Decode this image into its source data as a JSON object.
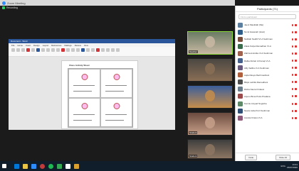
{
  "window": {
    "title": "Zoom Meeting",
    "recording_label": "Recording"
  },
  "shared_doc": {
    "word_title": "Document - Word",
    "tabs": [
      "File",
      "Home",
      "Insert",
      "Design",
      "Layout",
      "References",
      "Mailings",
      "Review",
      "View"
    ],
    "page_heading": "Class Activity Sheet"
  },
  "tiles": [
    {
      "name": "Teacher",
      "colors": [
        "#6a7b64",
        "#c9b9a3"
      ],
      "active": true
    },
    {
      "name": "",
      "colors": [
        "#4a4742",
        "#8a6e55"
      ],
      "active": false
    },
    {
      "name": "",
      "colors": [
        "#3b5e9a",
        "#c68d4a"
      ],
      "active": false
    },
    {
      "name": "Student",
      "colors": [
        "#6b4b3f",
        "#c7a089"
      ],
      "active": false
    },
    {
      "name": "Student",
      "colors": [
        "#3e3e3e",
        "#8d7662"
      ],
      "active": false
    }
  ],
  "participants": {
    "title": "Participants (71)",
    "search_placeholder": "Find a participant",
    "items": [
      {
        "name": "Jaeni Maulidah (Me)",
        "color": "#5c7fa0"
      },
      {
        "name": "Nurul Hasanah (Host)",
        "color": "#2e5d8a"
      },
      {
        "name": "Nabilah Nadhif VI-A Sudirman",
        "color": "#7a4e3c"
      },
      {
        "name": "Zakia Kalya Ramadhan VI-A",
        "color": "#3b6d4d"
      },
      {
        "name": "Zahira Anindita VI-A Sudirman",
        "color": "#a0624f"
      },
      {
        "name": "Rafka Zubair Al Faruqi VI-A",
        "color": "#46618c"
      },
      {
        "name": "Alfiy Saliha VI-A Sudirman",
        "color": "#6a5a7d"
      },
      {
        "name": "Aqila Rasya Rachmadzani",
        "color": "#b05f3c"
      },
      {
        "name": "Bilqis Lathifa Ramadhani",
        "color": "#4d4d4d"
      },
      {
        "name": "Risha Naura Firdausi",
        "color": "#6b7e8e"
      },
      {
        "name": "Arjuno Bima Putra Pradana",
        "color": "#9b4b4b"
      },
      {
        "name": "Kenzie Arsyad Nugraha",
        "color": "#5e8a6a"
      },
      {
        "name": "Naura Aulia Putri Sudirman",
        "color": "#2f4f77"
      },
      {
        "name": "Aurelia Kirana VI-A",
        "color": "#8d5a7a"
      }
    ],
    "invite_label": "Invite",
    "mute_all_label": "Mute All"
  },
  "taskbar": {
    "time": "13:41",
    "date": "15/07/2020",
    "lang": "ENG",
    "icons": [
      "#0078d7",
      "#e8c547",
      "#2d8cff",
      "#c13b3b",
      "#1db954",
      "#34a853",
      "#ffffff",
      "#d9a030"
    ]
  }
}
